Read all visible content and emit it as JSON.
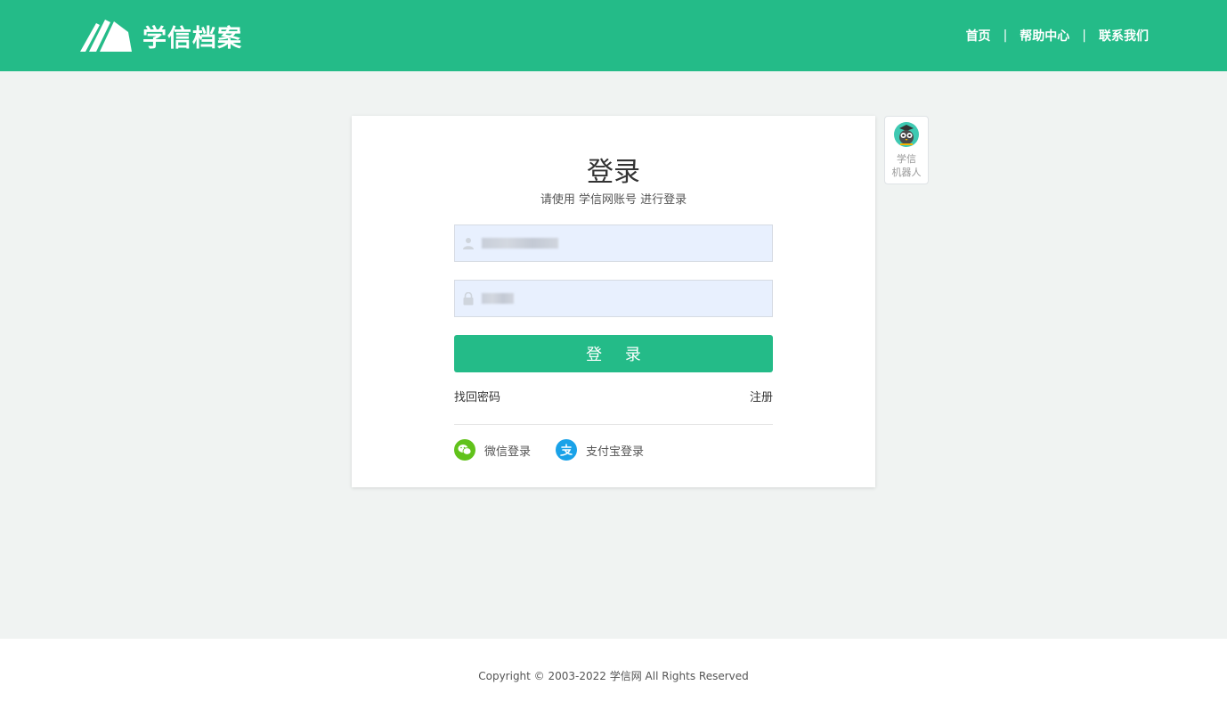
{
  "header": {
    "logo_text": "学信档案",
    "nav": [
      {
        "label": "首页"
      },
      {
        "label": "帮助中心"
      },
      {
        "label": "联系我们"
      }
    ],
    "separator": "|"
  },
  "login": {
    "title": "登录",
    "subtitle": "请使用 学信网账号 进行登录",
    "button_label": "登 录",
    "forgot_label": "找回密码",
    "register_label": "注册",
    "third_party": [
      {
        "label": "微信登录",
        "icon": "wechat-icon",
        "color": "#61c21b"
      },
      {
        "label": "支付宝登录",
        "icon": "alipay-icon",
        "color": "#1aa2e8"
      }
    ]
  },
  "robot": {
    "line1": "学信",
    "line2": "机器人",
    "icon": "owl-avatar-icon"
  },
  "footer": {
    "copyright": "Copyright © 2003-2022 学信网 All Rights Reserved"
  },
  "colors": {
    "brand": "#24bb88",
    "background": "#f0f3f2",
    "input_bg": "#e8f0fe"
  }
}
